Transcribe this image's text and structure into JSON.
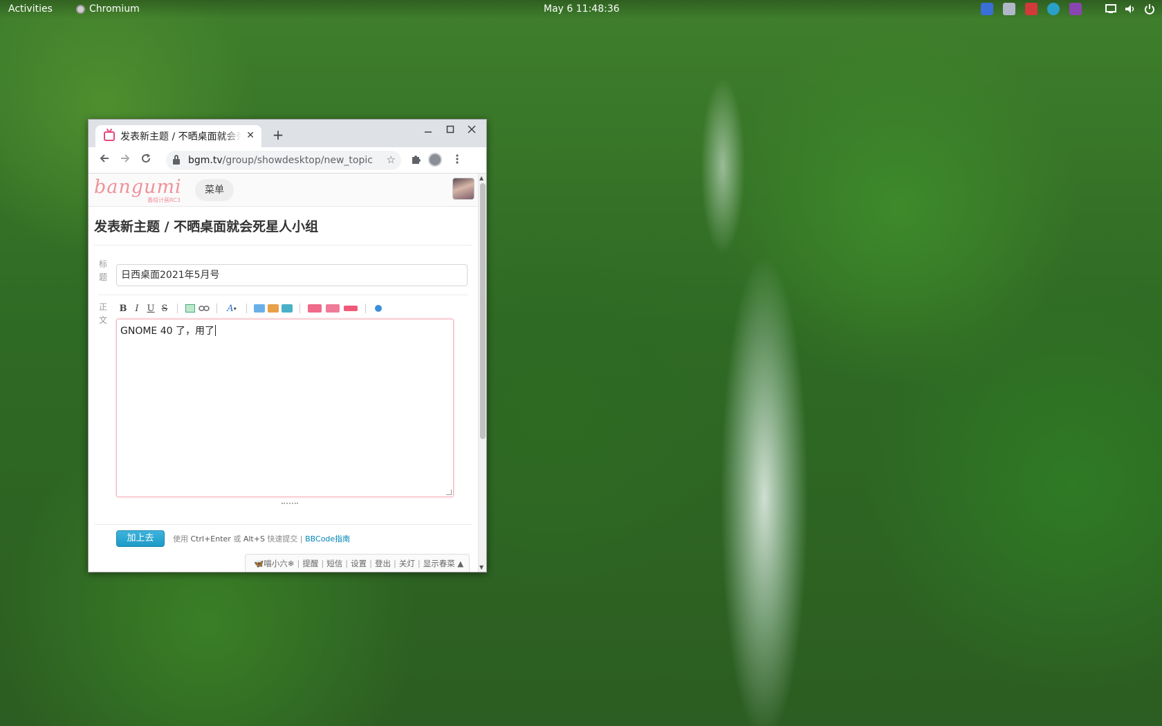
{
  "topbar": {
    "activities": "Activities",
    "app_name": "Chromium",
    "clock": "May 6  11:48:36",
    "tray_icons": [
      {
        "name": "tray-app-1-icon",
        "color": "#3a6fd8"
      },
      {
        "name": "tray-app-2-icon",
        "color": "#b0b8c8"
      },
      {
        "name": "tray-app-3-icon",
        "color": "#d23a3a"
      },
      {
        "name": "tray-app-4-icon",
        "color": "#2aa0c8"
      },
      {
        "name": "tray-app-5-icon",
        "color": "#8a46b0"
      }
    ],
    "system_icons": [
      "screen-icon",
      "volume-icon",
      "power-icon"
    ]
  },
  "browser": {
    "tab_title": "发表新主题 / 不晒桌面就会死星人小组",
    "tab_close": "✕",
    "new_tab": "+",
    "url_host": "bgm.tv",
    "url_path": "/group/showdesktop/new_topic"
  },
  "site": {
    "logo": "bangumi",
    "logo_sub": "番组计画RC3",
    "menu_label": "菜单"
  },
  "form": {
    "page_title": "发表新主题 / 不晒桌面就会死星人小组",
    "title_label_1": "标",
    "title_label_2": "题",
    "title_value": "日西桌面2021年5月号",
    "body_label_1": "正",
    "body_label_2": "文",
    "body_text": "GNOME 40 了，用了",
    "toolbar": {
      "bold": "B",
      "italic": "I",
      "underline": "U",
      "strike": "S",
      "font": "A"
    },
    "submit_label": "加上去",
    "hint_prefix": "使用",
    "hint_key1": "Ctrl+Enter",
    "hint_or": "或",
    "hint_key2": "Alt+S",
    "hint_suffix": "快速提交 |",
    "hint_link": "BBCode指南"
  },
  "dock": {
    "user": "🦋喵小六❄",
    "remind": "提醒",
    "pm": "短信",
    "settings": "设置",
    "logout": "登出",
    "lights_off": "关灯",
    "show_menu": "显示春菜 ▲"
  }
}
